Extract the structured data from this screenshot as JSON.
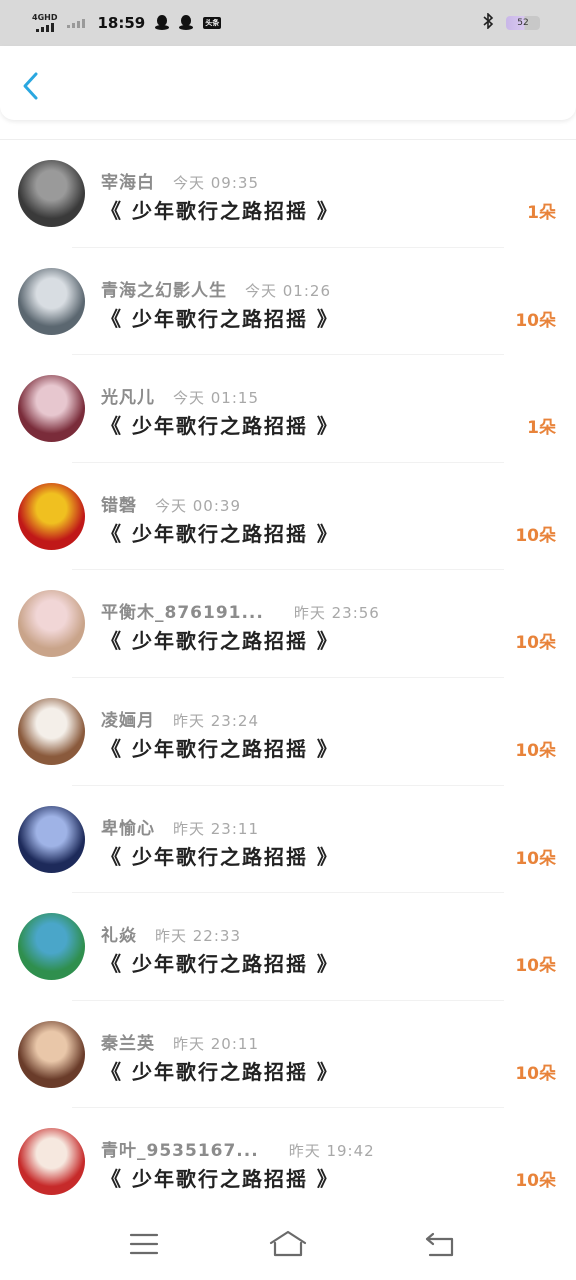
{
  "status_bar": {
    "network": "4GHD",
    "time": "18:59",
    "notif_badge": "头条",
    "battery": "52"
  },
  "header": {
    "title": ""
  },
  "items": [
    {
      "name": "宰海白",
      "time": "今天 09:35",
      "text": "《 少年歌行之路招摇 》",
      "gift": "1朵",
      "avatar": [
        "#3a3a3a",
        "#9a9a9a"
      ]
    },
    {
      "name": "青海之幻影人生",
      "time": "今天 01:26",
      "text": "《 少年歌行之路招摇 》",
      "gift": "10朵",
      "avatar": [
        "#5b6770",
        "#d8dde2"
      ]
    },
    {
      "name": "光凡儿",
      "time": "今天 01:15",
      "text": "《 少年歌行之路招摇 》",
      "gift": "1朵",
      "avatar": [
        "#7a2c3a",
        "#e7c7cf"
      ]
    },
    {
      "name": "错磬",
      "time": "今天 00:39",
      "text": "《 少年歌行之路招摇 》",
      "gift": "10朵",
      "avatar": [
        "#c01818",
        "#f0c020"
      ]
    },
    {
      "name": "平衡木_876191...",
      "time": "昨天 23:56",
      "text": "《 少年歌行之路招摇 》",
      "gift": "10朵",
      "avatar": [
        "#c9a48a",
        "#f1d6d6"
      ]
    },
    {
      "name": "凌婳月",
      "time": "昨天 23:24",
      "text": "《 少年歌行之路招摇 》",
      "gift": "10朵",
      "avatar": [
        "#8a5a3c",
        "#f4efe9"
      ]
    },
    {
      "name": "卑愉心",
      "time": "昨天 23:11",
      "text": "《 少年歌行之路招摇 》",
      "gift": "10朵",
      "avatar": [
        "#1d2a5a",
        "#9fb3e6"
      ]
    },
    {
      "name": "礼焱",
      "time": "昨天 22:33",
      "text": "《 少年歌行之路招摇 》",
      "gift": "10朵",
      "avatar": [
        "#2f8f4e",
        "#4aa6c9"
      ]
    },
    {
      "name": "秦兰英",
      "time": "昨天 20:11",
      "text": "《 少年歌行之路招摇 》",
      "gift": "10朵",
      "avatar": [
        "#6a3c2a",
        "#e9c7a9"
      ]
    },
    {
      "name": "青叶_9535167...",
      "time": "昨天 19:42",
      "text": "《 少年歌行之路招摇 》",
      "gift": "10朵",
      "avatar": [
        "#c62a2a",
        "#f6e8df"
      ]
    }
  ],
  "colors": {
    "accent": "#2aa7e0",
    "gift": "#e8833a"
  },
  "nav": {
    "icons": [
      "menu-icon",
      "home-icon",
      "back-icon"
    ]
  }
}
